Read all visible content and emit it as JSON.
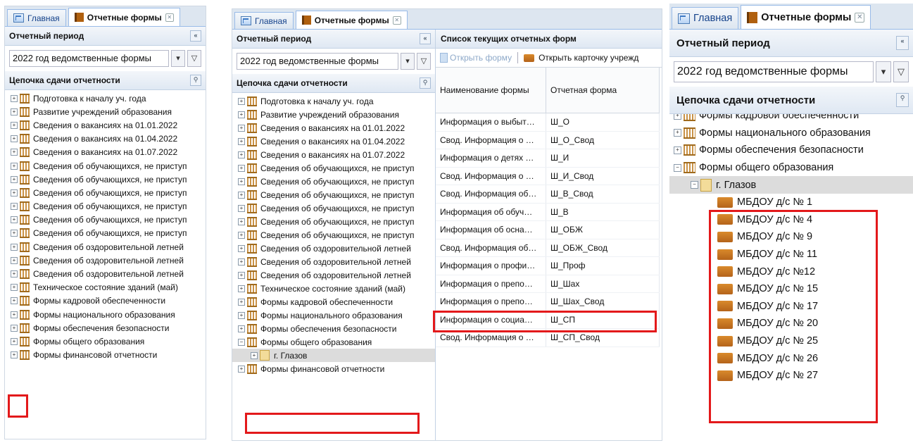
{
  "tabs": {
    "home": "Главная",
    "forms": "Отчетные формы",
    "close": "✕"
  },
  "period": {
    "title": "Отчетный период",
    "value": "2022 год ведомственные формы",
    "collapse": "«",
    "dropdown": "▾",
    "filter": "▽"
  },
  "chain": {
    "title": "Цепочка сдачи отчетности",
    "search": "⚲"
  },
  "tree_items": [
    "Подготовка к началу уч. года",
    "Развитие учреждений образования",
    "Сведения о вакансиях на 01.01.2022",
    "Сведения о вакансиях на 01.04.2022",
    "Сведения о вакансиях на 01.07.2022",
    "Сведения об обучающихся, не приступ",
    "Сведения об обучающихся, не приступ",
    "Сведения об обучающихся, не приступ",
    "Сведения об обучающихся, не приступ",
    "Сведения об обучающихся, не приступ",
    "Сведения об обучающихся, не приступ",
    "Сведения об оздоровительной летней",
    "Сведения об оздоровительной летней",
    "Сведения об оздоровительной летней",
    "Техническое состояние зданий (май)",
    "Формы кадровой обеспеченности",
    "Формы национального образования",
    "Формы обеспечения безопасности",
    "Формы общего образования",
    "Формы финансовой отчетности"
  ],
  "tree_child": "г. Глазов",
  "grid": {
    "title": "Список текущих отчетных форм",
    "open_form": "Открыть форму",
    "open_card": "Открыть карточку учрежд",
    "col_name": "Наименование формы",
    "col_form": "Отчетная форма",
    "rows": [
      {
        "name": "Информация о выбыт…",
        "form": "Ш_О"
      },
      {
        "name": "Свод. Информация о …",
        "form": "Ш_О_Свод"
      },
      {
        "name": "Информация о детях …",
        "form": "Ш_И"
      },
      {
        "name": "Свод. Информация о …",
        "form": "Ш_И_Свод"
      },
      {
        "name": "Свод. Информация об…",
        "form": "Ш_В_Свод"
      },
      {
        "name": "Информация об обуч…",
        "form": "Ш_В"
      },
      {
        "name": "Информация об осна…",
        "form": "Ш_ОБЖ"
      },
      {
        "name": "Свод. Информация об…",
        "form": "Ш_ОБЖ_Свод"
      },
      {
        "name": "Информация о профи…",
        "form": "Ш_Проф"
      },
      {
        "name": "Информация о препо…",
        "form": "Ш_Шах"
      },
      {
        "name": "Информация о препо…",
        "form": "Ш_Шах_Свод"
      },
      {
        "name": "Информация о социа…",
        "form": "Ш_СП"
      },
      {
        "name": "Свод. Информация о …",
        "form": "Ш_СП_Свод"
      }
    ]
  },
  "zoom": {
    "top_cut": "Формы кадровой обеспеченности",
    "items": [
      "Формы национального образования",
      "Формы обеспечения безопасности",
      "Формы общего образования"
    ],
    "city": "г. Глазов",
    "schools": [
      "МБДОУ д/с № 1",
      "МБДОУ д/с № 4",
      "МБДОУ д/с № 9",
      "МБДОУ д/с № 11",
      "МБДОУ д/с №12",
      "МБДОУ д/с № 15",
      "МБДОУ д/с № 17",
      "МБДОУ д/с № 20",
      "МБДОУ д/с № 25",
      "МБДОУ д/с № 26",
      "МБДОУ д/с № 27"
    ]
  },
  "colors": {
    "highlight": "#e3191b",
    "header_text": "#15428b",
    "border": "#99bbe8"
  }
}
